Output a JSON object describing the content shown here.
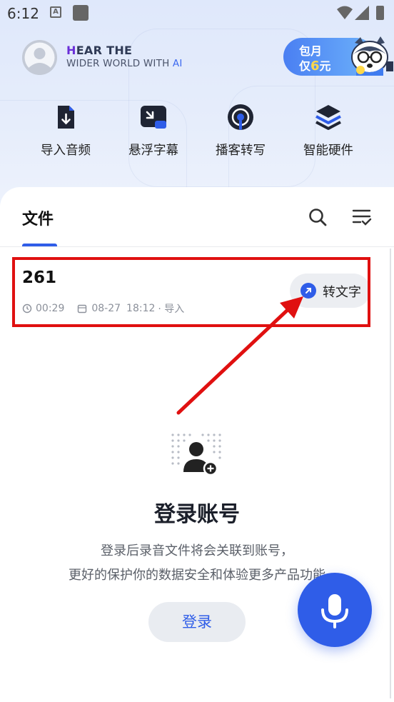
{
  "status_bar": {
    "time": "6:12"
  },
  "header": {
    "slogan_line1_h": "H",
    "slogan_line1_rest": "EAR THE",
    "slogan_line2_main": "WIDER WORLD WITH ",
    "slogan_line2_ai": "AI",
    "promo": {
      "line1": "包月",
      "line2_pre": "仅",
      "line2_num": "6",
      "line2_post": "元"
    }
  },
  "quick_actions": [
    {
      "label": "导入音频",
      "icon": "import-audio-icon"
    },
    {
      "label": "悬浮字幕",
      "icon": "floating-subtitle-icon"
    },
    {
      "label": "播客转写",
      "icon": "podcast-icon"
    },
    {
      "label": "智能硬件",
      "icon": "smart-hardware-icon"
    }
  ],
  "files_tab": {
    "title": "文件"
  },
  "file_item": {
    "name": "261",
    "duration": "00:29",
    "date": "08-27",
    "time": "18:12",
    "source": "· 导入",
    "convert_label": "转文字"
  },
  "login": {
    "title": "登录账号",
    "desc_line1": "登录后录音文件将会关联到账号，",
    "desc_line2": "更好的保护你的数据安全和体验更多产品功能",
    "button": "登录"
  },
  "colors": {
    "accent": "#2f5de8",
    "highlight": "#e01010"
  }
}
